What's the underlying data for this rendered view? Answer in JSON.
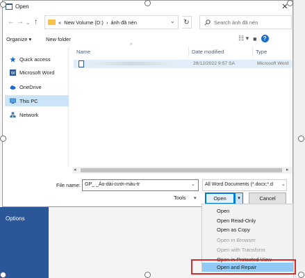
{
  "dialog": {
    "title": "Open",
    "close_glyph": "✕",
    "address": {
      "prefix": "«",
      "path": [
        "New Volume (D:)",
        "ảnh đã nén"
      ],
      "separator": "›"
    },
    "search_placeholder": "Search ảnh đã nén",
    "organize_label": "Organize ▾",
    "new_folder_label": "New folder",
    "sidebar": [
      {
        "label": "Quick access",
        "icon": "star-icon"
      },
      {
        "label": "Microsoft Word",
        "icon": "word-icon"
      },
      {
        "label": "OneDrive",
        "icon": "cloud-icon"
      },
      {
        "label": "This PC",
        "icon": "computer-icon",
        "selected": true
      },
      {
        "label": "Network",
        "icon": "network-icon"
      }
    ],
    "columns": [
      "Name",
      "Date modified",
      "Type"
    ],
    "file": {
      "date": "28/12/2022 9:57 SA",
      "type": "Microsoft Word"
    },
    "file_name_label": "File name:",
    "file_name_value": "GP_                              _Áo-dài-cưới-màu-tr",
    "filter_value": "All Word Documents (*.docx;*.d",
    "tools_label": "Tools",
    "open_label": "Open",
    "cancel_label": "Cancel"
  },
  "open_menu": [
    {
      "label": "Open",
      "enabled": true
    },
    {
      "label": "Open Read-Only",
      "enabled": true
    },
    {
      "label": "Open as Copy",
      "enabled": true
    },
    {
      "label": "Open in Browser",
      "enabled": false
    },
    {
      "label": "Open with Transform",
      "enabled": false
    },
    {
      "label": "Open in Protected View",
      "enabled": true
    },
    {
      "label": "Open and Repair",
      "enabled": true,
      "highlighted": true
    }
  ],
  "word_backstage": {
    "options_label": "Options"
  },
  "colors": {
    "accent": "#0078d7",
    "word_blue": "#2b579a",
    "highlight": "#91c9f7",
    "annotation_red": "#d12d2d"
  }
}
